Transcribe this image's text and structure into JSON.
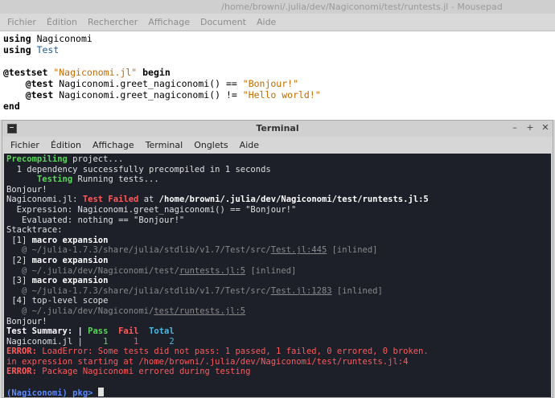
{
  "mousepad": {
    "title": "/home/browni/.julia/dev/Nagiconomi/test/runtests.jl - Mousepad",
    "menu": [
      "Fichier",
      "Édition",
      "Rechercher",
      "Affichage",
      "Document",
      "Aide"
    ],
    "code": {
      "l1_kw": "using",
      "l1_mod": "Nagiconomi",
      "l2_kw": "using",
      "l2_mod": "Test",
      "l4_macro": "@testset",
      "l4_str": "\"Nagiconomi.jl\"",
      "l4_kw": "begin",
      "l5_macro": "@test",
      "l5_expr": "Nagiconomi.greet_nagiconomi() ==",
      "l5_str": "\"Bonjour!\"",
      "l6_macro": "@test",
      "l6_expr": "Nagiconomi.greet_nagiconomi() !=",
      "l6_str": "\"Hello world!\"",
      "l7_kw": "end"
    }
  },
  "terminal": {
    "title": "Terminal",
    "menu": [
      "Fichier",
      "Édition",
      "Affichage",
      "Terminal",
      "Onglets",
      "Aide"
    ],
    "lines": {
      "precompiling": "Precompiling",
      "project": " project...",
      "dependency": "  1 dependency successfully precompiled in 1 seconds",
      "testing": "Testing",
      "running": " Running tests...",
      "bonjour1": "Bonjour!",
      "fail_prefix": "Nagiconomi.jl: ",
      "test_failed": "Test Failed",
      "at": " at ",
      "fail_path": "/home/browni/.julia/dev/Nagiconomi/test/runtests.jl:5",
      "expression": "  Expression: Nagiconomi.greet_nagiconomi() == \"Bonjour!\"",
      "evaluated": "   Evaluated: nothing == \"Bonjour!\"",
      "stacktrace": "Stacktrace:",
      "st1_num": " [1] ",
      "st1_name": "macro expansion",
      "st1_at": "   @ ~/julia-1.7.3/share/julia/stdlib/v1.7/Test/src/",
      "st1_file": "Test.jl:445",
      "st1_tag": " [inlined]",
      "st2_num": " [2] ",
      "st2_name": "macro expansion",
      "st2_at": "   @ ~/.julia/dev/Nagiconomi/test/",
      "st2_file": "runtests.jl:5",
      "st2_tag": " [inlined]",
      "st3_num": " [3] ",
      "st3_name": "macro expansion",
      "st3_at": "   @ ~/julia-1.7.3/share/julia/stdlib/v1.7/Test/src/",
      "st3_file": "Test.jl:1283",
      "st3_tag": " [inlined]",
      "st4_num": " [4] ",
      "st4_name": "top-level scope",
      "st4_at": "   @ ~/.julia/dev/Nagiconomi/",
      "st4_file": "test/runtests.jl:5",
      "bonjour2": "Bonjour!",
      "summary_label": "Test Summary: | ",
      "pass": "Pass",
      "fail": "Fail",
      "total": "Total",
      "row_name": "Nagiconomi.jl | ",
      "pass_n": "   1",
      "fail_n": "     1",
      "total_n": "      2",
      "error1": "ERROR:",
      "error1_msg": " LoadError: Some tests did not pass: 1 passed, 1 failed, 0 errored, 0 broken.",
      "in_expr": "in expression starting at /home/browni/.julia/dev/Nagiconomi/test/runtests.jl:4",
      "error2": "ERROR:",
      "error2_msg": " Package Nagiconomi errored during testing",
      "prompt": "(Nagiconomi) pkg> "
    }
  }
}
